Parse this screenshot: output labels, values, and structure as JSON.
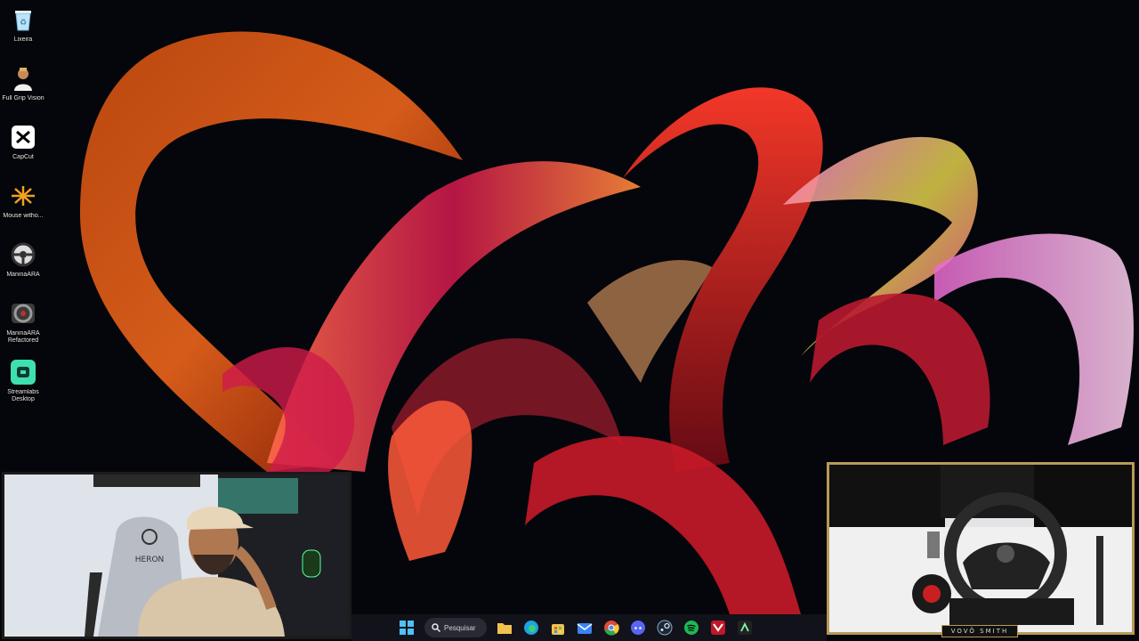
{
  "desktop": {
    "icons": [
      {
        "label": "Lixeira",
        "icon": "recycle-bin-icon"
      },
      {
        "label": "Full Grip Vision",
        "icon": "person-app-icon"
      },
      {
        "label": "CapCut",
        "icon": "capcut-icon"
      },
      {
        "label": "Mouse witho...",
        "icon": "mouse-app-icon"
      },
      {
        "label": "ManinaARA",
        "icon": "steering-wheel-icon"
      },
      {
        "label": "ManinaARA Refactored",
        "icon": "steering-wheel-icon"
      },
      {
        "label": "Streamlabs Desktop",
        "icon": "streamlabs-icon"
      }
    ]
  },
  "taskbar": {
    "search_label": "Pesquisar",
    "apps": [
      {
        "name": "file-explorer",
        "icon": "folder-icon",
        "color": "#f2c14e"
      },
      {
        "name": "edge",
        "icon": "edge-icon",
        "color": "#1fa3e0"
      },
      {
        "name": "store",
        "icon": "store-icon",
        "color": "#f2c14e"
      },
      {
        "name": "mail",
        "icon": "mail-icon",
        "color": "#3b82f6"
      },
      {
        "name": "chrome",
        "icon": "chrome-icon",
        "color": "#e04a3a"
      },
      {
        "name": "discord",
        "icon": "discord-icon",
        "color": "#5865f2"
      },
      {
        "name": "steam",
        "icon": "steam-icon",
        "color": "#1b2838"
      },
      {
        "name": "spotify",
        "icon": "spotify-icon",
        "color": "#1db954"
      },
      {
        "name": "app-red",
        "icon": "app-icon",
        "color": "#c0182a"
      },
      {
        "name": "app-dark",
        "icon": "app-icon",
        "color": "#222"
      }
    ]
  },
  "overlays": {
    "streamer_name": "VOVÔ SMITH",
    "webcam_chair_text": "HERON"
  },
  "colors": {
    "background": "#05060b",
    "accent_gold": "#b89a58"
  }
}
